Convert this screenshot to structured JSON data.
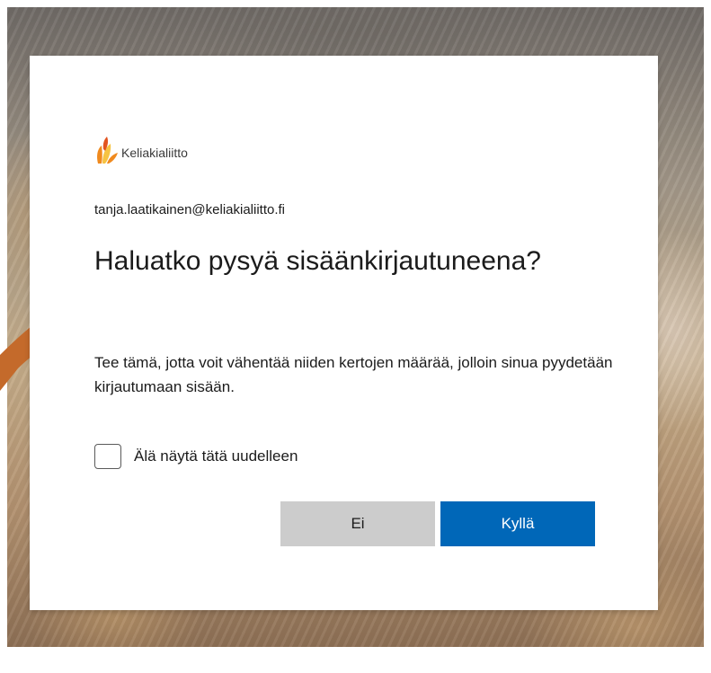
{
  "brand": {
    "name": "Keliakialiitto",
    "colors": {
      "logo_orange": "#f08a1e",
      "logo_yellow": "#f6c343",
      "logo_red": "#e2531f",
      "primary_button": "#0067b8",
      "secondary_button": "#cccccc",
      "accent_arc": "#c46a2b"
    }
  },
  "dialog": {
    "account_email": "tanja.laatikainen@keliakialiitto.fi",
    "title": "Haluatko pysyä sisäänkirjautuneena?",
    "description": "Tee tämä, jotta voit vähentää niiden kertojen määrää, jolloin sinua pyydetään kirjautumaan sisään.",
    "checkbox": {
      "label": "Älä näytä tätä uudelleen",
      "checked": false
    },
    "buttons": {
      "no_label": "Ei",
      "yes_label": "Kyllä"
    }
  },
  "icons": {
    "logo": "wheat-leaf-logo-icon",
    "checkbox": "checkbox-unchecked-icon"
  }
}
